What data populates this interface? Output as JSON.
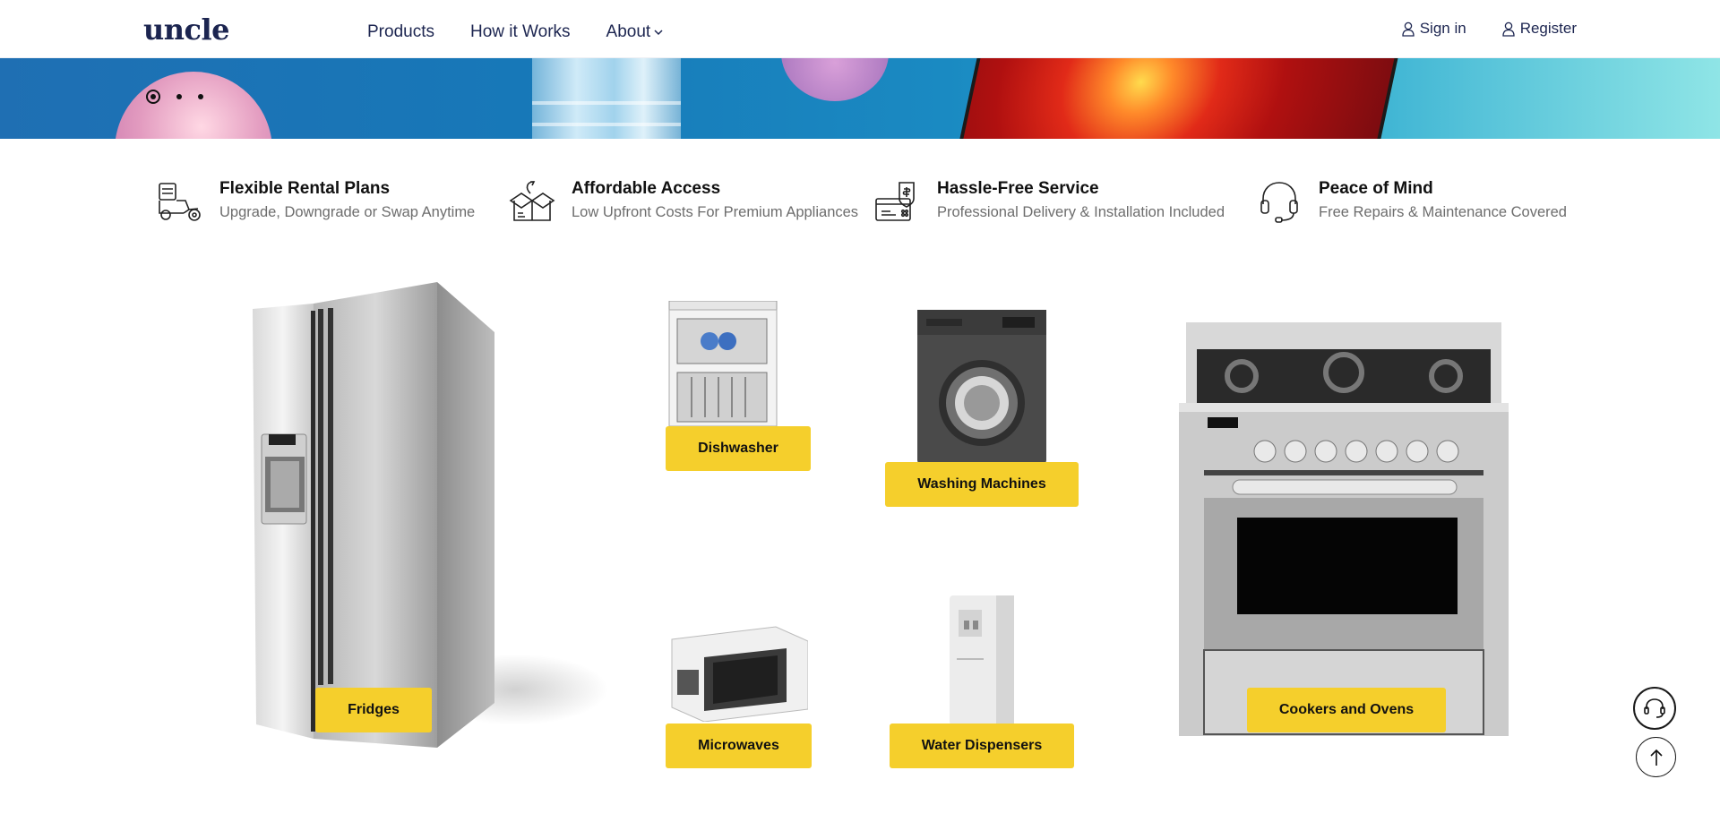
{
  "header": {
    "logo": "uncle",
    "nav": {
      "products": "Products",
      "how": "How it Works",
      "about": "About"
    },
    "auth": {
      "signin": "Sign in",
      "register": "Register"
    }
  },
  "hero": {
    "slide_count": 3,
    "active_slide": 1
  },
  "features": [
    {
      "title": "Flexible Rental Plans",
      "subtitle": "Upgrade, Downgrade or Swap Anytime",
      "icon": "delivery-scooter-icon"
    },
    {
      "title": "Affordable Access",
      "subtitle": "Low Upfront Costs For Premium Appliances",
      "icon": "open-box-icon"
    },
    {
      "title": "Hassle-Free Service",
      "subtitle": "Professional Delivery & Installation Included",
      "icon": "payment-card-icon"
    },
    {
      "title": "Peace of Mind",
      "subtitle": "Free Repairs & Maintenance Covered",
      "icon": "headset-icon"
    }
  ],
  "products": {
    "fridges": "Fridges",
    "dishwasher": "Dishwasher",
    "washing": "Washing Machines",
    "microwaves": "Microwaves",
    "water": "Water Dispensers",
    "cookers": "Cookers and Ovens"
  },
  "colors": {
    "brand": "#1c2550",
    "cta_yellow": "#f5cf2c"
  }
}
